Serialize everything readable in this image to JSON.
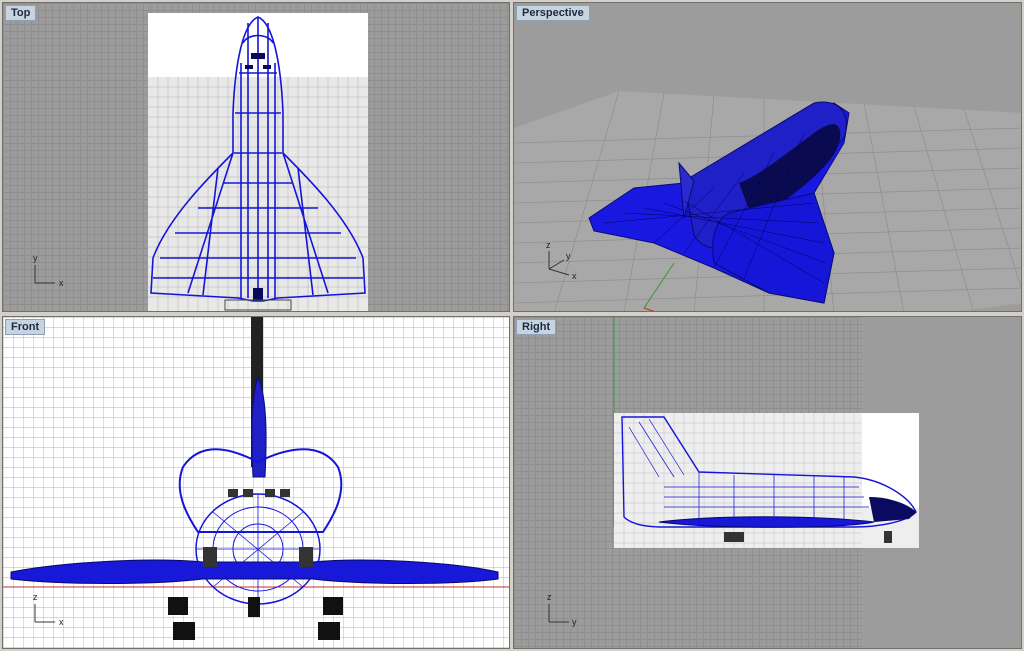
{
  "viewports": {
    "top": {
      "label": "Top"
    },
    "perspective": {
      "label": "Perspective"
    },
    "front": {
      "label": "Front"
    },
    "right": {
      "label": "Right"
    }
  },
  "axes": {
    "top": {
      "a": "y",
      "b": "x"
    },
    "perspective": {
      "a": "z",
      "b": "y",
      "c": "x"
    },
    "front": {
      "a": "z",
      "b": "x"
    },
    "right": {
      "a": "z",
      "b": "y"
    }
  },
  "colors": {
    "model": "#1515d8",
    "viewport_bg": "#9c9c9c",
    "label_bg": "#c8d3e0",
    "axis_red": "#c03030",
    "axis_green": "#2e9a2e"
  }
}
